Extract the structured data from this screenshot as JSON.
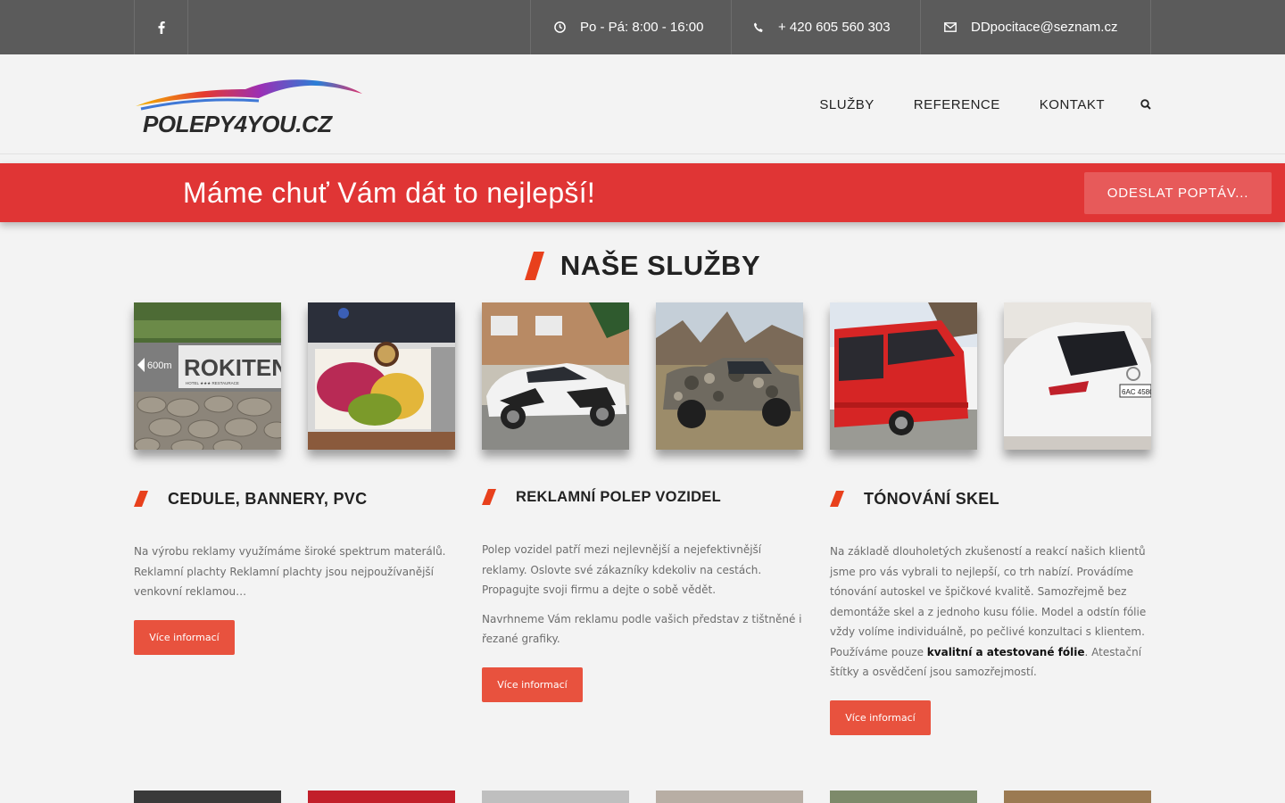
{
  "topbar": {
    "hours": "Po - Pá: 8:00 - 16:00",
    "phone": "+ 420 605 560 303",
    "email": "DDpocitace@seznam.cz"
  },
  "header": {
    "logo_text": "POLEPY4YOU.CZ",
    "nav": [
      "SLUŽBY",
      "REFERENCE",
      "KONTAKT"
    ]
  },
  "banner": {
    "text": "Máme chuť Vám dát to nejlepší!",
    "button": "ODESLAT POPTÁV..."
  },
  "section": {
    "title": "NAŠE SLUŽBY"
  },
  "thumbs": {
    "sign_text": "ROKITEN",
    "sign_distance": "600m",
    "sign_sub": "HOTEL ★★★ RESTAURACE",
    "plate_text": "6AC 4580"
  },
  "services": [
    {
      "title": "CEDULE, BANNERY, PVC",
      "paragraphs": [
        "Na výrobu reklamy využímáme široké spektrum materálů. Reklamní plachty Reklamní plachty jsou nejpoužívanější venkovní reklamou…"
      ],
      "button": "Více informací"
    },
    {
      "title": "REKLAMNÍ POLEP VOZIDEL",
      "paragraphs": [
        "Polep vozidel patří mezi nejlevnější a nejefektivnější reklamy. Oslovte své zákazníky kdekoliv na cestách. Propagujte svoji firmu a dejte o sobě vědět.",
        "Navrhneme Vám reklamu podle vašich představ z tištněné i řezané grafiky."
      ],
      "button": "Více informací"
    },
    {
      "title": "TÓNOVÁNÍ SKEL",
      "p_before": "Na základě dlouholetých zkušeností a reakcí našich klientů jsme pro vás vybrali to nejlepší, co trh nabízí. Provádíme tónování autoskel ve špičkové kvalitě. Samozřejmě bez demontáže skel a z jednoho kusu fólie. Model a odstín fólie vždy volíme individuálně, po pečlivé konzultaci s klientem. Používáme pouze ",
      "p_bold": "kvalitní a atestované fólie",
      "p_after": ". Atestační štítky a osvědčení jsou samozřejmostí.",
      "button": "Více informací"
    }
  ],
  "colors": {
    "topbar": "#5b5b5b",
    "banner": "#e03535",
    "accent": "#e8523e"
  }
}
